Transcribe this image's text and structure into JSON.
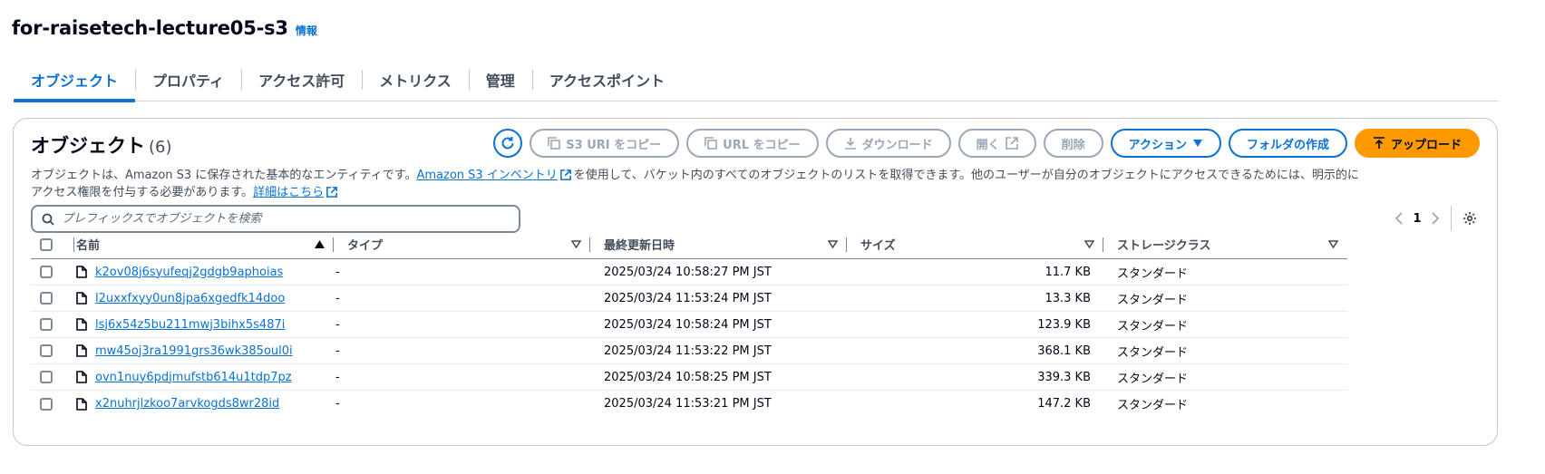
{
  "bucket": {
    "name": "for-raisetech-lecture05-s3",
    "info": "情報"
  },
  "tabs": [
    "オブジェクト",
    "プロパティ",
    "アクセス許可",
    "メトリクス",
    "管理",
    "アクセスポイント"
  ],
  "panel": {
    "title": "オブジェクト",
    "count": "(6)",
    "buttons": {
      "copy_s3_uri": "S3 URI をコピー",
      "copy_url": "URL をコピー",
      "download": "ダウンロード",
      "open": "開く",
      "delete": "削除",
      "actions": "アクション",
      "create_folder": "フォルダの作成",
      "upload": "アップロード"
    },
    "description": {
      "part1": "オブジェクトは、Amazon S3 に保存された基本的なエンティティです。",
      "link1": "Amazon S3 インベントリ",
      "part2": "を使用して、バケット内のすべてのオブジェクトのリストを取得できます。他のユーザーが自分のオブジェクトにアクセスできるためには、明示的に",
      "part3": "アクセス権限を付与する必要があります。",
      "link2": "詳細はこちら"
    },
    "search_placeholder": "プレフィックスでオブジェクトを検索",
    "page": "1"
  },
  "table": {
    "columns": {
      "name": "名前",
      "type": "タイプ",
      "modified": "最終更新日時",
      "size": "サイズ",
      "storage_class": "ストレージクラス"
    },
    "rows": [
      {
        "name": "k2ov08j6syufeqj2gdgb9aphoias",
        "type": "-",
        "modified": "2025/03/24 10:58:27 PM JST",
        "size": "11.7 KB",
        "storage_class": "スタンダード"
      },
      {
        "name": "l2uxxfxyy0un8jpa6xgedfk14doo",
        "type": "-",
        "modified": "2025/03/24 11:53:24 PM JST",
        "size": "13.3 KB",
        "storage_class": "スタンダード"
      },
      {
        "name": "lsj6x54z5bu211mwj3bihx5s487i",
        "type": "-",
        "modified": "2025/03/24 10:58:24 PM JST",
        "size": "123.9 KB",
        "storage_class": "スタンダード"
      },
      {
        "name": "mw45oj3ra1991grs36wk385oul0i",
        "type": "-",
        "modified": "2025/03/24 11:53:22 PM JST",
        "size": "368.1 KB",
        "storage_class": "スタンダード"
      },
      {
        "name": "ovn1nuy6pdjmufstb614u1tdp7pz",
        "type": "-",
        "modified": "2025/03/24 10:58:25 PM JST",
        "size": "339.3 KB",
        "storage_class": "スタンダード"
      },
      {
        "name": "x2nuhrjlzkoo7arvkogds8wr28id",
        "type": "-",
        "modified": "2025/03/24 11:53:21 PM JST",
        "size": "147.2 KB",
        "storage_class": "スタンダード"
      }
    ]
  },
  "colors": {
    "accent": "#0972d3",
    "upload": "#ff9900",
    "disabled": "#9ba7b6",
    "text": "#000716"
  },
  "icons": [
    "refresh-icon",
    "copy-icon",
    "download-icon",
    "external-link-icon",
    "caret-down-icon",
    "upload-icon",
    "search-icon",
    "chevron-left-icon",
    "chevron-right-icon",
    "gear-icon",
    "file-icon",
    "sort-ascending-icon",
    "sort-icon"
  ]
}
